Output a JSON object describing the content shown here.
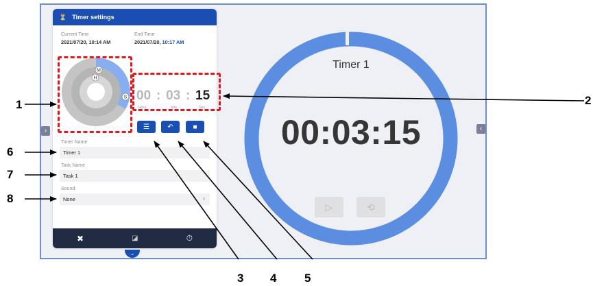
{
  "timer": {
    "title": "Timer 1",
    "display": "00:03:15",
    "ring_fraction": 0.98
  },
  "panel": {
    "header_title": "Timer settings",
    "current_time_label": "Current Time",
    "current_time_value": "2021/07/20, 10:14 AM",
    "end_time_label": "End Time",
    "end_time_date": "2021/07/20, ",
    "end_time_clock": "10:17 AM",
    "dial": {
      "h": "H",
      "m": "M",
      "s": "S"
    },
    "hms": {
      "hours": "00",
      "minutes": "03",
      "seconds": "15",
      "sep": ":",
      "hour_label": "Hour",
      "min_label": "Min",
      "sec_label": "Sec"
    },
    "fields": {
      "timer_name_label": "Timer Name",
      "timer_name_value": "Timer 1",
      "task_name_label": "Task Name",
      "task_name_value": "Task 1",
      "sound_label": "Sound",
      "sound_value": "None"
    }
  },
  "callouts": [
    "1",
    "2",
    "3",
    "4",
    "5",
    "6",
    "7",
    "8"
  ],
  "colors": {
    "accent": "#1a4fb1",
    "ring": "#5b8de0",
    "annotation": "#e1191e"
  },
  "icons": {
    "header": "timer-settings-icon",
    "list": "list-icon",
    "undo": "undo-icon",
    "save": "save-icon",
    "close": "close-icon",
    "shrink": "shrink-icon",
    "stopwatch": "stopwatch-icon",
    "play": "play-icon",
    "reset": "reset-icon"
  }
}
